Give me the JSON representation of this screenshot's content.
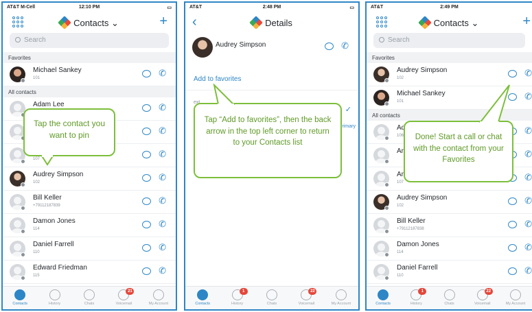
{
  "colors": {
    "accent": "#2d86c6",
    "callout_border": "#7cbf3a",
    "callout_text": "#5f9a27",
    "badge": "#e5463a"
  },
  "panel1": {
    "status": {
      "carrier": "AT&T M-Cell",
      "time": "12:10 PM"
    },
    "title": "Contacts",
    "search_placeholder": "Search",
    "favorites_header": "Favorites",
    "favorites": [
      {
        "name": "Michael Sankey",
        "sub": "101"
      }
    ],
    "all_header": "All contacts",
    "contacts": [
      {
        "name": "Adam Lee",
        "sub": ""
      },
      {
        "name": "",
        "sub": ""
      },
      {
        "name": "",
        "sub": "107"
      },
      {
        "name": "Audrey Simpson",
        "sub": "102"
      },
      {
        "name": "Bill Keller",
        "sub": "+79112187839"
      },
      {
        "name": "Damon Jones",
        "sub": "114"
      },
      {
        "name": "Daniel Farrell",
        "sub": "110"
      },
      {
        "name": "Edward Friedman",
        "sub": "115"
      }
    ],
    "callout": "Tap the contact you want to pin",
    "tabs": [
      {
        "label": "Contacts",
        "badge": ""
      },
      {
        "label": "History",
        "badge": ""
      },
      {
        "label": "Chats",
        "badge": ""
      },
      {
        "label": "Voicemail",
        "badge": "21"
      },
      {
        "label": "My Account",
        "badge": ""
      }
    ]
  },
  "panel2": {
    "status": {
      "carrier": "AT&T",
      "time": "2:48 PM"
    },
    "title": "Details",
    "contact_name": "Audrey Simpson",
    "add_favorites": "Add to favorites",
    "ext_label": "ext.",
    "ext_value": "102",
    "primary_label": "Primary",
    "callout": "Tap “Add to favorites”, then the back arrow in the top left corner to return to your Contacts list",
    "tabs": [
      {
        "label": "Contacts",
        "badge": ""
      },
      {
        "label": "History",
        "badge": "1"
      },
      {
        "label": "Chats",
        "badge": ""
      },
      {
        "label": "Voicemail",
        "badge": "22"
      },
      {
        "label": "My Account",
        "badge": ""
      }
    ]
  },
  "panel3": {
    "status": {
      "carrier": "AT&T",
      "time": "2:49 PM"
    },
    "title": "Contacts",
    "search_placeholder": "Search",
    "favorites_header": "Favorites",
    "favorites": [
      {
        "name": "Audrey Simpson",
        "sub": "102"
      },
      {
        "name": "Michael Sankey",
        "sub": "101"
      }
    ],
    "all_header": "All contacts",
    "contacts": [
      {
        "name": "Ada",
        "sub": "106"
      },
      {
        "name": "Anc",
        "sub": ""
      },
      {
        "name": "Ant",
        "sub": "107"
      },
      {
        "name": "Audrey Simpson",
        "sub": "102"
      },
      {
        "name": "Bill Keller",
        "sub": "+79112187838"
      },
      {
        "name": "Damon Jones",
        "sub": "114"
      },
      {
        "name": "Daniel Farrell",
        "sub": "110"
      }
    ],
    "callout": "Done! Start a call or chat with the contact from your Favorites",
    "tabs": [
      {
        "label": "Contacts",
        "badge": ""
      },
      {
        "label": "History",
        "badge": "1"
      },
      {
        "label": "Chats",
        "badge": ""
      },
      {
        "label": "Voicemail",
        "badge": "22"
      },
      {
        "label": "My Account",
        "badge": ""
      }
    ]
  }
}
